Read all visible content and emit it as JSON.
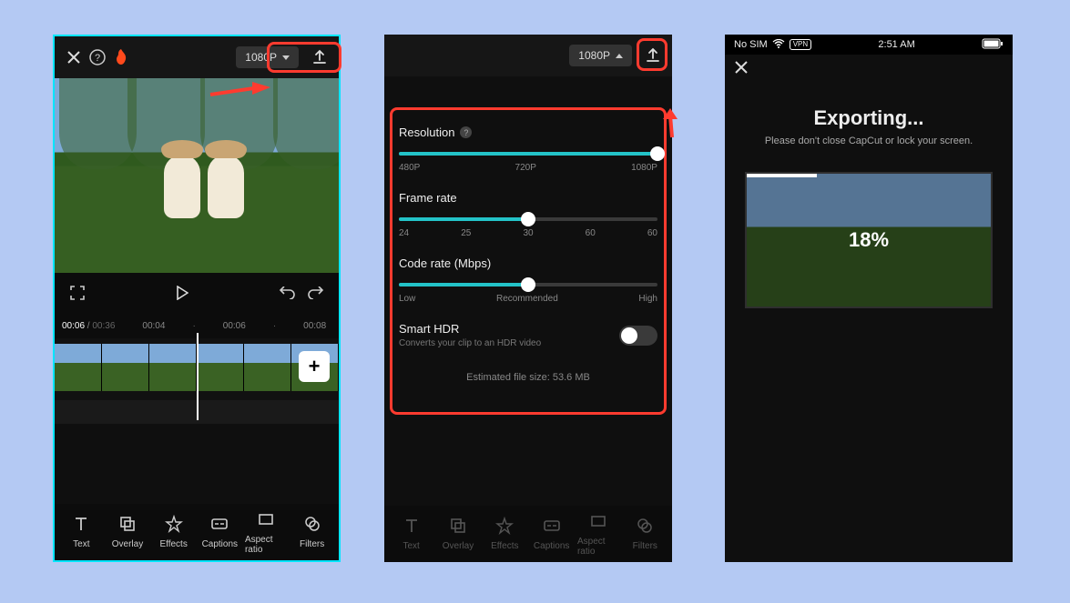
{
  "panel1": {
    "resolution_chip": "1080P",
    "time_current": "00:06",
    "time_duration": "00:36",
    "timecodes": [
      "00:04",
      "00:06",
      "00:08"
    ],
    "add_label": "+"
  },
  "panel2": {
    "resolution_chip": "1080P",
    "settings": {
      "resolution": {
        "label": "Resolution",
        "ticks": [
          "480P",
          "720P",
          "1080P"
        ],
        "fill_pct": 100
      },
      "framerate": {
        "label": "Frame rate",
        "ticks": [
          "24",
          "25",
          "30",
          "60",
          "60"
        ],
        "fill_pct": 50
      },
      "coderate": {
        "label": "Code rate (Mbps)",
        "ticks": [
          "Low",
          "Recommended",
          "High"
        ],
        "fill_pct": 50
      },
      "hdr": {
        "label": "Smart HDR",
        "note": "Converts your clip to an HDR video",
        "on": false
      }
    },
    "estimated_label": "Estimated file size: 53.6 MB"
  },
  "panel3": {
    "status": {
      "carrier": "No SIM",
      "vpn": "VPN",
      "time": "2:51 AM"
    },
    "title": "Exporting...",
    "subtitle": "Please don't close CapCut or lock your screen.",
    "progress_pct": 18,
    "progress_label": "18%"
  },
  "tools": [
    {
      "key": "text",
      "label": "Text"
    },
    {
      "key": "overlay",
      "label": "Overlay"
    },
    {
      "key": "effects",
      "label": "Effects"
    },
    {
      "key": "captions",
      "label": "Captions"
    },
    {
      "key": "aspect",
      "label": "Aspect ratio"
    },
    {
      "key": "filters",
      "label": "Filters"
    }
  ]
}
